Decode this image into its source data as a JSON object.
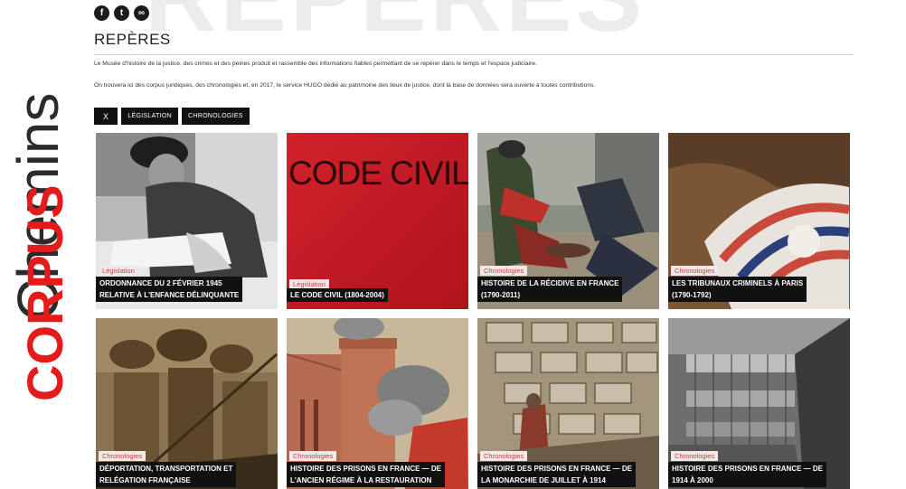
{
  "watermark": "REPÈRES",
  "vertical": {
    "corpus": "CORPUS",
    "chemin": "Chemins"
  },
  "socials": [
    {
      "icon": "facebook-icon",
      "glyph": "f"
    },
    {
      "icon": "twitter-icon",
      "glyph": "t"
    },
    {
      "icon": "link-icon",
      "glyph": "∞"
    }
  ],
  "title": "REPÈRES",
  "intro": {
    "p1": "Le Musée d'histoire de la justice, des crimes et des peines produit et rassemble des informations fiables permettant de se repérer dans le temps et l'espace judiciaire.",
    "p2": "On trouvera ici des corpus juridiques, des chronologies et, en 2017, le service HUGO dédié au patrimoine des lieux de justice, dont la base de données sera ouverte à toutes contributions."
  },
  "filters": {
    "clear": "X",
    "legislation": "LÉGISLATION",
    "chronologies": "CHRONOLOGIES"
  },
  "cards": [
    {
      "label": "Législation",
      "title1": "ORDONNANCE DU 2 FÉVRIER 1945",
      "title2": "RELATIVE À L'ENFANCE DÉLINQUANTE"
    },
    {
      "label": "Législation",
      "title1": "LE CODE CIVIL (1804-2004)",
      "title2": "",
      "image_text": "CODE CIVIL"
    },
    {
      "label": "Chronologies",
      "title1": "HISTOIRE DE LA RÉCIDIVE EN FRANCE",
      "title2": "(1790-2011)"
    },
    {
      "label": "Chronologies",
      "title1": "LES TRIBUNAUX CRIMINELS À PARIS",
      "title2": "(1790-1792)"
    },
    {
      "label": "Chronologies",
      "title1": "DÉPORTATION, TRANSPORTATION ET",
      "title2": "RELÉGATION FRANÇAISE"
    },
    {
      "label": "Chronologies",
      "title1": "HISTOIRE DES PRISONS EN FRANCE — DE",
      "title2": "L'ANCIEN RÉGIME À LA RESTAURATION"
    },
    {
      "label": "Chronologies",
      "title1": "HISTOIRE DES PRISONS EN FRANCE — DE",
      "title2": "LA MONARCHIE DE JUILLET À 1914"
    },
    {
      "label": "Chronologies",
      "title1": "HISTOIRE DES PRISONS EN FRANCE — DE",
      "title2": "1914 À 2000"
    }
  ]
}
